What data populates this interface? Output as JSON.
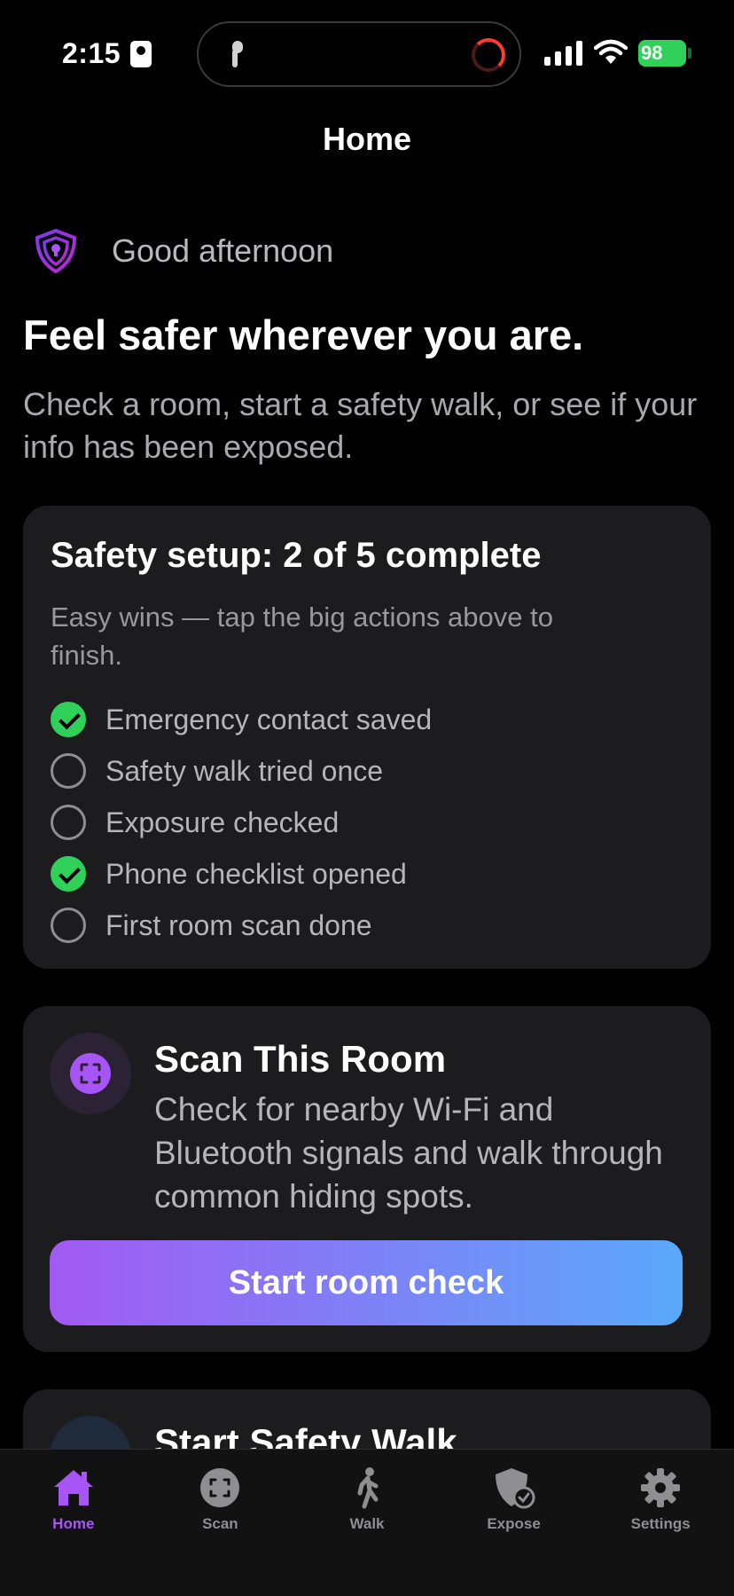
{
  "status_bar": {
    "time": "2:15",
    "battery": "98"
  },
  "nav": {
    "title": "Home"
  },
  "greeting": "Good afternoon",
  "headline": "Feel safer wherever you are.",
  "subtitle": "Check a room, start a safety walk, or see if your info has been exposed.",
  "setup": {
    "title": "Safety setup: 2 of 5 complete",
    "completed": 2,
    "total": 5,
    "description": "Easy wins — tap the big actions above to finish.",
    "items": [
      {
        "label": "Emergency contact saved",
        "done": true
      },
      {
        "label": "Safety walk tried once",
        "done": false
      },
      {
        "label": "Exposure checked",
        "done": false
      },
      {
        "label": "Phone checklist opened",
        "done": true
      },
      {
        "label": "First room scan done",
        "done": false
      }
    ]
  },
  "scan_card": {
    "title": "Scan This Room",
    "description": "Check for nearby Wi-Fi and Bluetooth signals and walk through common hiding spots.",
    "button": "Start room check",
    "icon": "scan-icon"
  },
  "walk_card": {
    "title": "Start Safety Walk",
    "icon": "walk-icon"
  },
  "tabs": [
    {
      "label": "Home",
      "icon": "home-icon",
      "active": true
    },
    {
      "label": "Scan",
      "icon": "scan-icon",
      "active": false
    },
    {
      "label": "Walk",
      "icon": "walk-icon",
      "active": false
    },
    {
      "label": "Expose",
      "icon": "shield-check-icon",
      "active": false
    },
    {
      "label": "Settings",
      "icon": "gear-icon",
      "active": false
    }
  ],
  "colors": {
    "accent": "#a855f7",
    "success": "#30d158",
    "card": "#1c1c1e",
    "gradient_start": "#a259f2",
    "gradient_end": "#5aa9fa"
  }
}
